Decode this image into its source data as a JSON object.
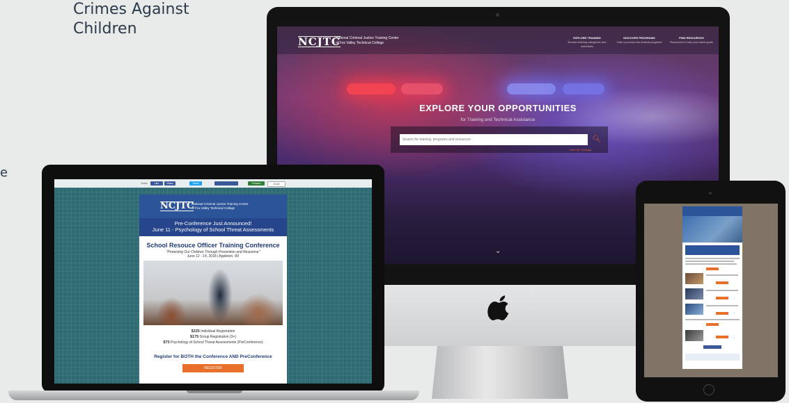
{
  "caption": {
    "text": "Crimes Against\nChildren"
  },
  "edge_fragment": "e",
  "imac_site": {
    "logo": "NCJTC",
    "logo_sub": "National Criminal Justice Training Center\nof Fox Valley Technical College",
    "nav": [
      {
        "label": "EXPLORE TRAINING",
        "sub": "Browse training categories and schedules"
      },
      {
        "label": "DISCOVER PROGRAMS",
        "sub": "Take a journey into federal programs"
      },
      {
        "label": "FIND RESOURCES",
        "sub": "Resources to help you reach goals"
      }
    ],
    "hero_title": "EXPLORE YOUR OPPORTUNITIES",
    "hero_subtitle": "for Training and Technical Assistance",
    "search_placeholder": "Search for training, programs and resources",
    "view_all": "View All Trainings",
    "scroll_chevron": "⌄"
  },
  "laptop_email": {
    "share_bar": [
      "Share",
      "Like",
      "Share",
      "Tweet",
      "Forward",
      "Email"
    ],
    "logo": "NCJTC",
    "logo_sub": "National Criminal Justice Training Center\nof Fox Valley Technical College",
    "band_line1": "Pre-Conference Just Announced!",
    "band_line2": "June 11 - Psychology of School Threat Assessments",
    "title": "School Resouce Officer Training Conference",
    "tagline": "\"Protecting Our Children Through Prevention and Response\"",
    "date": "June 12 - 14, 2018 | Appleton, WI",
    "prices": [
      {
        "amount": "$325",
        "label": "Individual Registration"
      },
      {
        "amount": "$175",
        "label": "Group Registration (3+)"
      },
      {
        "amount": "$75",
        "label": "Psychology of School Threat Assessments (PreConference)"
      }
    ],
    "cta_text": "Register for BOTH the Conference AND PreConference",
    "register_button": "REGISTER"
  },
  "colors": {
    "background": "#e9eaea",
    "brand_blue": "#2c5599",
    "accent_orange": "#e8702a",
    "teal_bg": "#2f6b73"
  }
}
